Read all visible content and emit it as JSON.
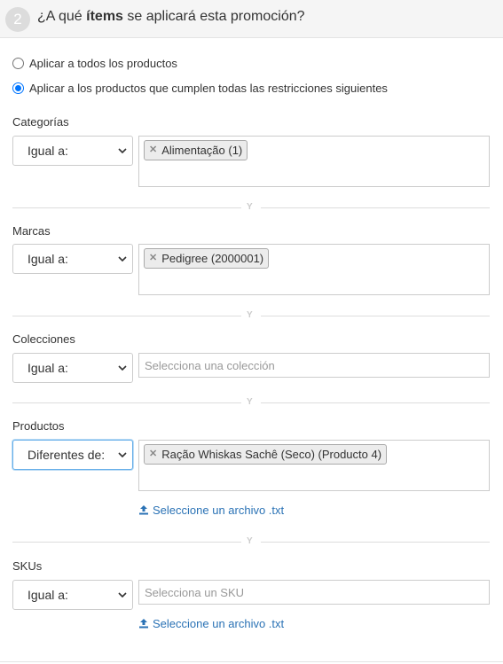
{
  "header": {
    "step": "2",
    "title_pre": "¿A qué ",
    "title_bold": "ítems",
    "title_post": " se aplicará esta promoción?"
  },
  "options": {
    "all": "Aplicar a todos los productos",
    "restricted": "Aplicar a los productos que cumplen todas las restricciones siguientes",
    "selected": "restricted"
  },
  "divider_label": "Y",
  "sections": {
    "categorias": {
      "label": "Categorías",
      "operator": "Igual a:",
      "tags": [
        "Alimentação (1)"
      ]
    },
    "marcas": {
      "label": "Marcas",
      "operator": "Igual a:",
      "tags": [
        "Pedigree (2000001)"
      ]
    },
    "colecciones": {
      "label": "Colecciones",
      "operator": "Igual a:",
      "placeholder": "Selecciona una colección"
    },
    "productos": {
      "label": "Productos",
      "operator": "Diferentes de:",
      "tags": [
        "Ração Whiskas Sachê (Seco) (Producto 4)"
      ],
      "upload": "Seleccione un archivo .txt"
    },
    "skus": {
      "label": "SKUs",
      "operator": "Igual a:",
      "placeholder": "Selecciona un SKU",
      "upload": "Seleccione un archivo .txt"
    }
  },
  "colors": {
    "accent": "#0075ff",
    "link": "#2a72b5"
  },
  "icons": {
    "chevron": "chevron-down-icon",
    "remove": "remove-tag-icon",
    "upload": "upload-icon"
  }
}
